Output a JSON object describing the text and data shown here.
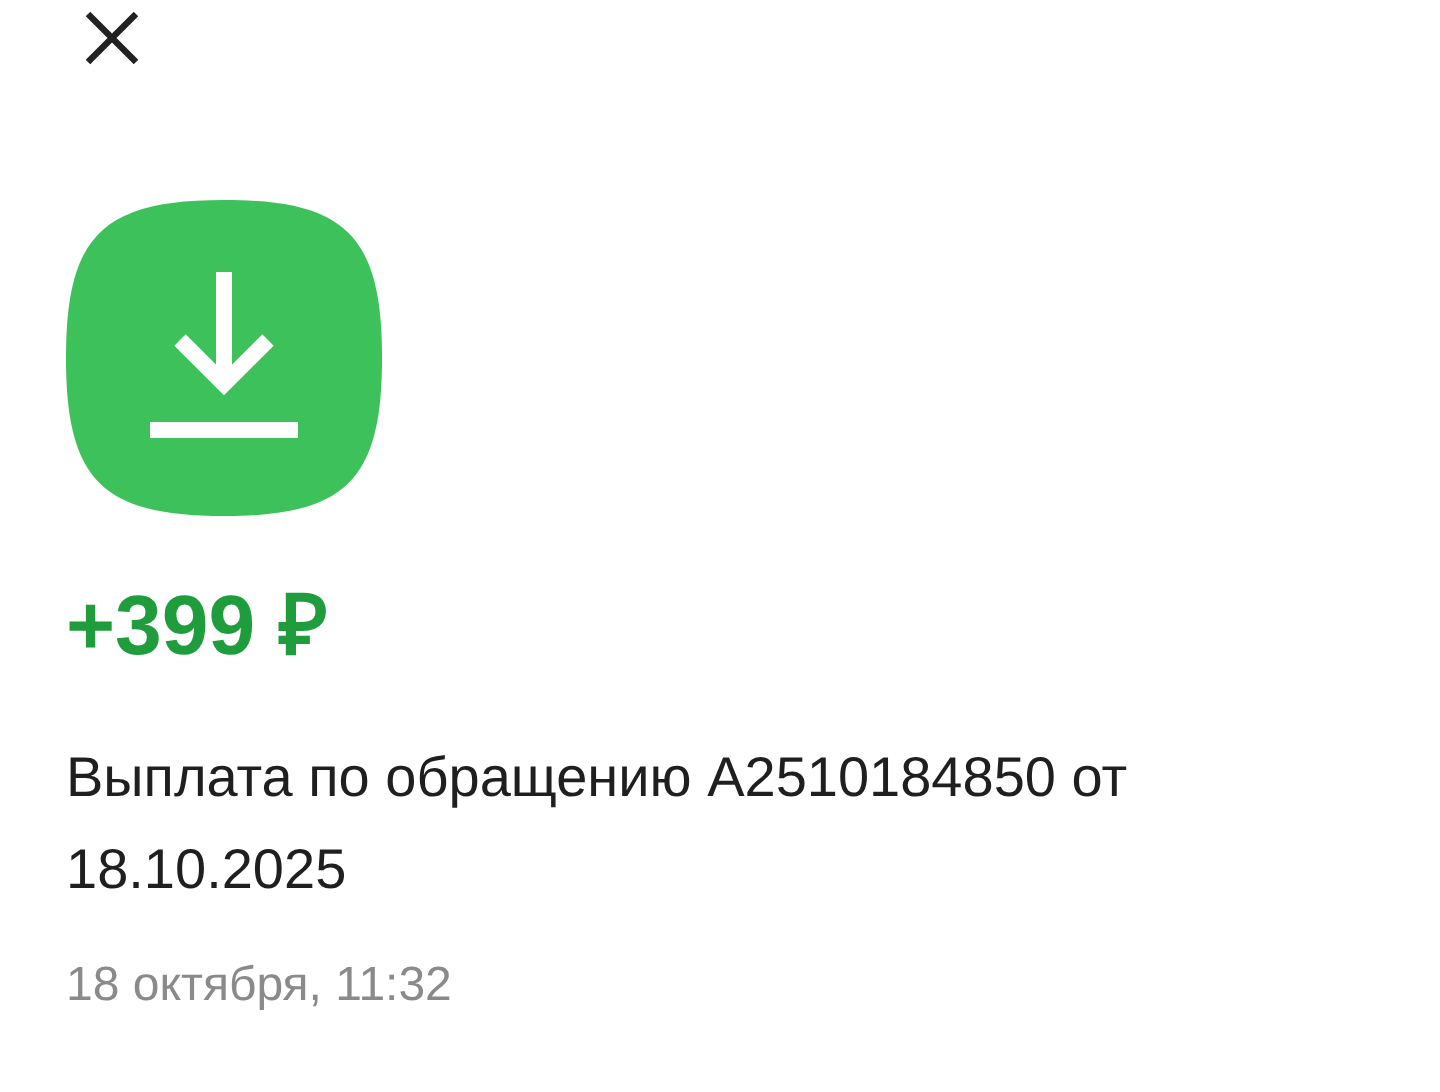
{
  "operation": {
    "amount": "+399 ₽",
    "description": "Выплата по обращению A2510184850 от 18.10.2025",
    "datetime": "18 октября, 11:32"
  }
}
